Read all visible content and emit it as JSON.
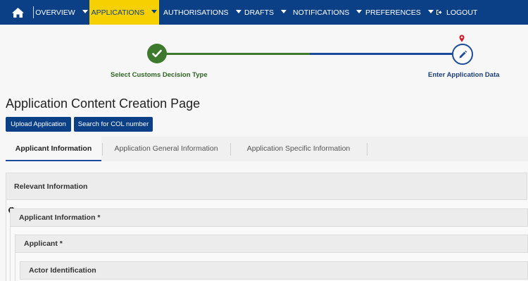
{
  "nav": {
    "items": [
      {
        "label": "OVERVIEW"
      },
      {
        "label": "APPLICATIONS"
      },
      {
        "label": "AUTHORISATIONS"
      },
      {
        "label": "DRAFTS"
      },
      {
        "label": "NOTIFICATIONS"
      },
      {
        "label": "PREFERENCES"
      }
    ],
    "logout_label": "LOGOUT",
    "active_color": "#f7d000",
    "bar_color": "#0b3f86"
  },
  "stepper": {
    "steps": [
      {
        "label": "Select Customs Decision Type",
        "status": "done"
      },
      {
        "label": "Enter Application Data",
        "status": "current"
      }
    ],
    "done_color": "#3d7a2e",
    "current_color": "#1b4b9a"
  },
  "page": {
    "title": "Application Content Creation Page",
    "upload_label": "Upload Application",
    "search_col_label": "Search for COL number"
  },
  "tabs": [
    {
      "label": "Applicant Information",
      "active": true
    },
    {
      "label": "Application General Information",
      "active": false
    },
    {
      "label": "Application Specific Information",
      "active": false
    }
  ],
  "sections": {
    "relevant": "Relevant Information",
    "applicant_info": "Applicant Information *",
    "applicant": "Applicant *",
    "actor_id": "Actor Identification"
  }
}
